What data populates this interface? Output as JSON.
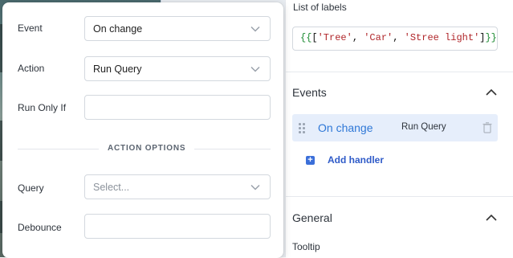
{
  "colors": {
    "accent": "#2f78d7",
    "handler_bg": "#e6eefb",
    "add_button": "#3b6fd9"
  },
  "popover": {
    "event": {
      "label": "Event",
      "value": "On change"
    },
    "action": {
      "label": "Action",
      "value": "Run Query"
    },
    "run_only_if": {
      "label": "Run Only If",
      "value": ""
    },
    "section_title": "ACTION OPTIONS",
    "query": {
      "label": "Query",
      "placeholder": "Select..."
    },
    "debounce": {
      "label": "Debounce",
      "value": ""
    }
  },
  "properties": {
    "list_of_labels": {
      "label": "List of labels",
      "brace_open": "{{",
      "bracket_open": "[",
      "items": [
        "'Tree'",
        "'Car'",
        "'Stree light'"
      ],
      "separator": ", ",
      "bracket_close": "]",
      "brace_close": "}}"
    },
    "events": {
      "title": "Events",
      "handler": {
        "event": "On change",
        "action": "Run Query"
      },
      "add_label": "Add handler"
    },
    "general": {
      "title": "General",
      "tooltip_label": "Tooltip"
    }
  },
  "icons": [
    "chevron-down-icon",
    "chevron-up-icon",
    "drag-handle-icon",
    "trash-icon",
    "plus-icon"
  ]
}
